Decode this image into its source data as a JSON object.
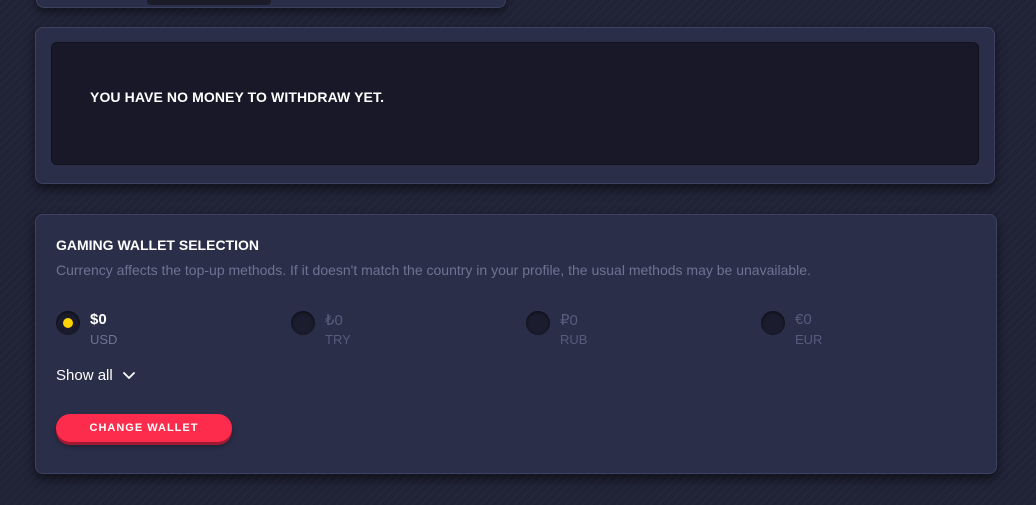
{
  "withdraw": {
    "message": "YOU HAVE NO MONEY TO WITHDRAW YET."
  },
  "wallet": {
    "title": "GAMING WALLET SELECTION",
    "description": "Currency affects the top-up methods. If it doesn't match the country in your profile, the usual methods may be unavailable.",
    "currencies": [
      {
        "amount": "$0",
        "code": "USD",
        "selected": true
      },
      {
        "amount": "₺0",
        "code": "TRY",
        "selected": false
      },
      {
        "amount": "₽0",
        "code": "RUB",
        "selected": false
      },
      {
        "amount": "€0",
        "code": "EUR",
        "selected": false
      }
    ],
    "show_all_label": "Show all",
    "change_wallet_label": "CHANGE WALLET"
  },
  "colors": {
    "accent": "#fd2b4c",
    "selected_radio": "#ffd400",
    "card_bg": "#2a2e48",
    "inner_bg": "#181828"
  },
  "icons": {
    "show_all": "chevron-down-icon"
  }
}
